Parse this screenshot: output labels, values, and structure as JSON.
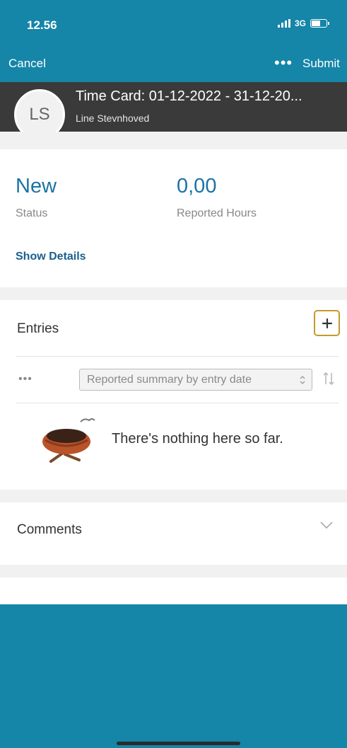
{
  "status_bar": {
    "time": "12.56",
    "network": "3G"
  },
  "nav": {
    "cancel_label": "Cancel",
    "more_label": "•••",
    "submit_label": "Submit"
  },
  "header": {
    "avatar_initials": "LS",
    "title": "Time Card: 01-12-2022 - 31-12-20...",
    "subtitle": "Line Stevnhoved"
  },
  "summary": {
    "status_value": "New",
    "status_label": "Status",
    "hours_value": "0,00",
    "hours_label": "Reported Hours",
    "show_details_label": "Show Details"
  },
  "entries": {
    "title": "Entries",
    "add_icon": "plus-icon",
    "more_label": "•••",
    "sort_select_value": "Reported summary by entry date",
    "sort_icon": "sort-icon",
    "empty_text": "There's nothing here so far."
  },
  "comments": {
    "title": "Comments",
    "expand_icon": "chevron-down-icon"
  },
  "colors": {
    "brand": "#1585a8",
    "header_bg": "#3a3a3a",
    "value_blue": "#1a73a6",
    "link_blue": "#1a5f8c",
    "add_border": "#c49a2a"
  }
}
